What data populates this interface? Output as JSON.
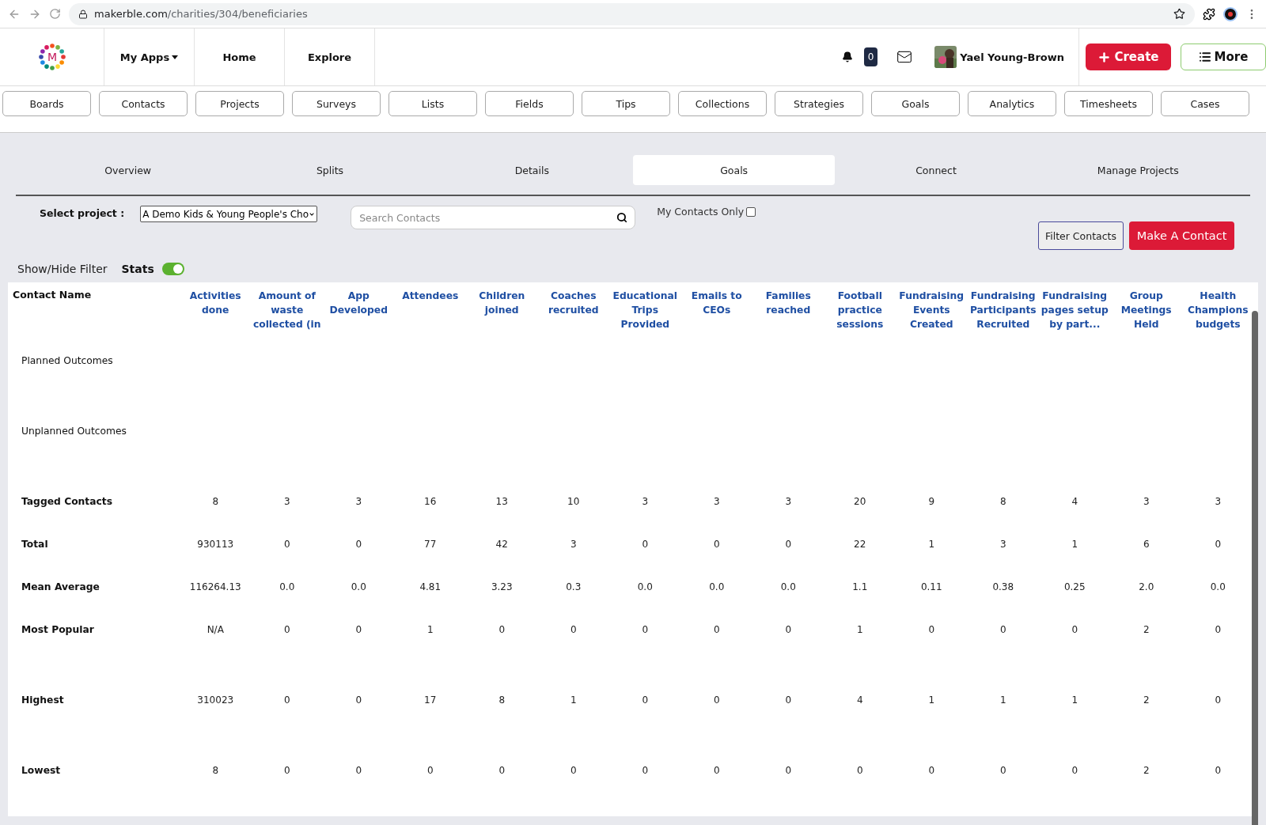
{
  "browser": {
    "url_host": "makerble.com",
    "url_path": "/charities/304/beneficiaries"
  },
  "header": {
    "logo_letter": "M",
    "nav": [
      {
        "label": "My Apps",
        "dropdown": true
      },
      {
        "label": "Home",
        "dropdown": false
      },
      {
        "label": "Explore",
        "dropdown": false
      }
    ],
    "notification_count": "0",
    "user_name": "Yael Young-Brown",
    "create_label": "Create",
    "more_label": "More"
  },
  "app_tabs": [
    "Boards",
    "Contacts",
    "Projects",
    "Surveys",
    "Lists",
    "Fields",
    "Tips",
    "Collections",
    "Strategies",
    "Goals",
    "Analytics",
    "Timesheets",
    "Cases"
  ],
  "section_tabs": [
    {
      "label": "Overview",
      "selected": false
    },
    {
      "label": "Splits",
      "selected": false
    },
    {
      "label": "Details",
      "selected": false
    },
    {
      "label": "Goals",
      "selected": true
    },
    {
      "label": "Connect",
      "selected": false
    },
    {
      "label": "Manage Projects",
      "selected": false
    }
  ],
  "filters": {
    "project_label": "Select project :",
    "project_value": "A Demo Kids & Young People's Cho",
    "search_placeholder": "Search Contacts",
    "my_contacts_label": "My Contacts Only",
    "my_contacts_checked": false,
    "filter_button": "Filter Contacts",
    "make_contact_button": "Make A Contact",
    "show_hide_label": "Show/Hide Filter",
    "stats_label": "Stats",
    "stats_on": true
  },
  "table": {
    "name_column": "Contact Name",
    "columns": [
      "Activities done",
      "Amount of waste collected (in",
      "App Developed",
      "Attendees",
      "Children joined",
      "Coaches recruited",
      "Educational Trips Provided",
      "Emails to CEOs",
      "Families reached",
      "Football practice sessions",
      "Fundraising Events Created",
      "Fundraising Participants Recruited",
      "Fundraising pages setup by part...",
      "Group Meetings Held",
      "Health Champions budgets"
    ],
    "rows": [
      {
        "kind": "section",
        "label": "Planned Outcomes"
      },
      {
        "kind": "section",
        "label": "Unplanned Outcomes"
      },
      {
        "kind": "stat",
        "label": "Tagged Contacts",
        "values": [
          "8",
          "3",
          "3",
          "16",
          "13",
          "10",
          "3",
          "3",
          "3",
          "20",
          "9",
          "8",
          "4",
          "3",
          "3"
        ]
      },
      {
        "kind": "stat",
        "label": "Total",
        "values": [
          "930113",
          "0",
          "0",
          "77",
          "42",
          "3",
          "0",
          "0",
          "0",
          "22",
          "1",
          "3",
          "1",
          "6",
          "0"
        ]
      },
      {
        "kind": "stat",
        "label": "Mean Average",
        "values": [
          "116264.13",
          "0.0",
          "0.0",
          "4.81",
          "3.23",
          "0.3",
          "0.0",
          "0.0",
          "0.0",
          "1.1",
          "0.11",
          "0.38",
          "0.25",
          "2.0",
          "0.0"
        ]
      },
      {
        "kind": "tall",
        "label": "Most Popular",
        "values": [
          "N/A",
          "0",
          "0",
          "1",
          "0",
          "0",
          "0",
          "0",
          "0",
          "1",
          "0",
          "0",
          "0",
          "2",
          "0"
        ]
      },
      {
        "kind": "tall",
        "label": "Highest",
        "values": [
          "310023",
          "0",
          "0",
          "17",
          "8",
          "1",
          "0",
          "0",
          "0",
          "4",
          "1",
          "1",
          "1",
          "2",
          "0"
        ]
      },
      {
        "kind": "tall",
        "label": "Lowest",
        "values": [
          "8",
          "0",
          "0",
          "0",
          "0",
          "0",
          "0",
          "0",
          "0",
          "0",
          "0",
          "0",
          "0",
          "2",
          "0"
        ]
      }
    ]
  }
}
